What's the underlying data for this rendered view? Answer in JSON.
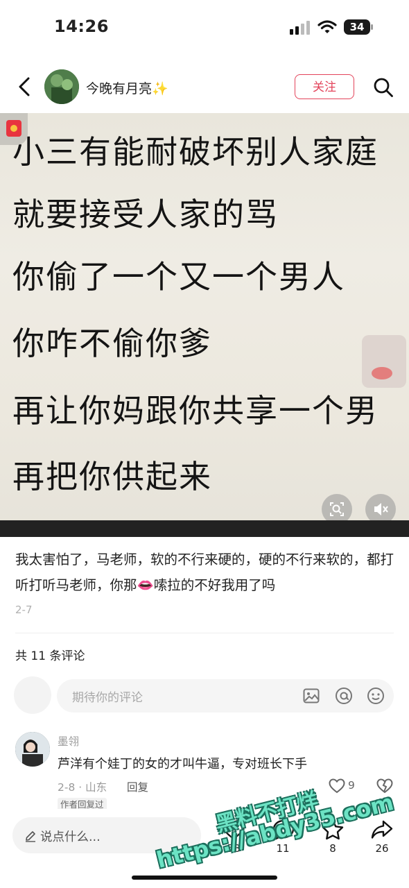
{
  "status_bar": {
    "time": "14:26",
    "battery": "34"
  },
  "header": {
    "author": "今晚有月亮✨",
    "follow_label": "关注"
  },
  "media": {
    "lines": [
      "小三有能耐破坏别人家庭",
      "就要接受人家的骂",
      "你偷了一个又一个男人",
      "你咋不偷你爹",
      "再让你妈跟你共享一个男",
      "再把你供起来"
    ]
  },
  "post": {
    "caption": "我太害怕了，马老师，软的不行来硬的，硬的不行来软的，都打听打听马老师，你那👄嗦拉的不好我用了吗",
    "date": "2-7"
  },
  "comments_section": {
    "count_label": "共 11 条评论",
    "input_placeholder": "期待你的评论",
    "items": [
      {
        "name": "墨翎",
        "text": "芦洋有个娃丁的女的才叫牛逼，专对班长下手",
        "meta": "2-8 · 山东",
        "reply_label": "回复",
        "likes": "9",
        "badge": "作者回复过"
      }
    ]
  },
  "bottom_bar": {
    "say_placeholder": "说点什么...",
    "likes": "58",
    "comments": "11",
    "stars": "8",
    "shares": "26"
  },
  "watermark": {
    "line1": "黑料不打烊",
    "line2": "https://abdy35.com"
  },
  "colors": {
    "accent": "#e3435a",
    "watermark": "#6ce3c4"
  }
}
